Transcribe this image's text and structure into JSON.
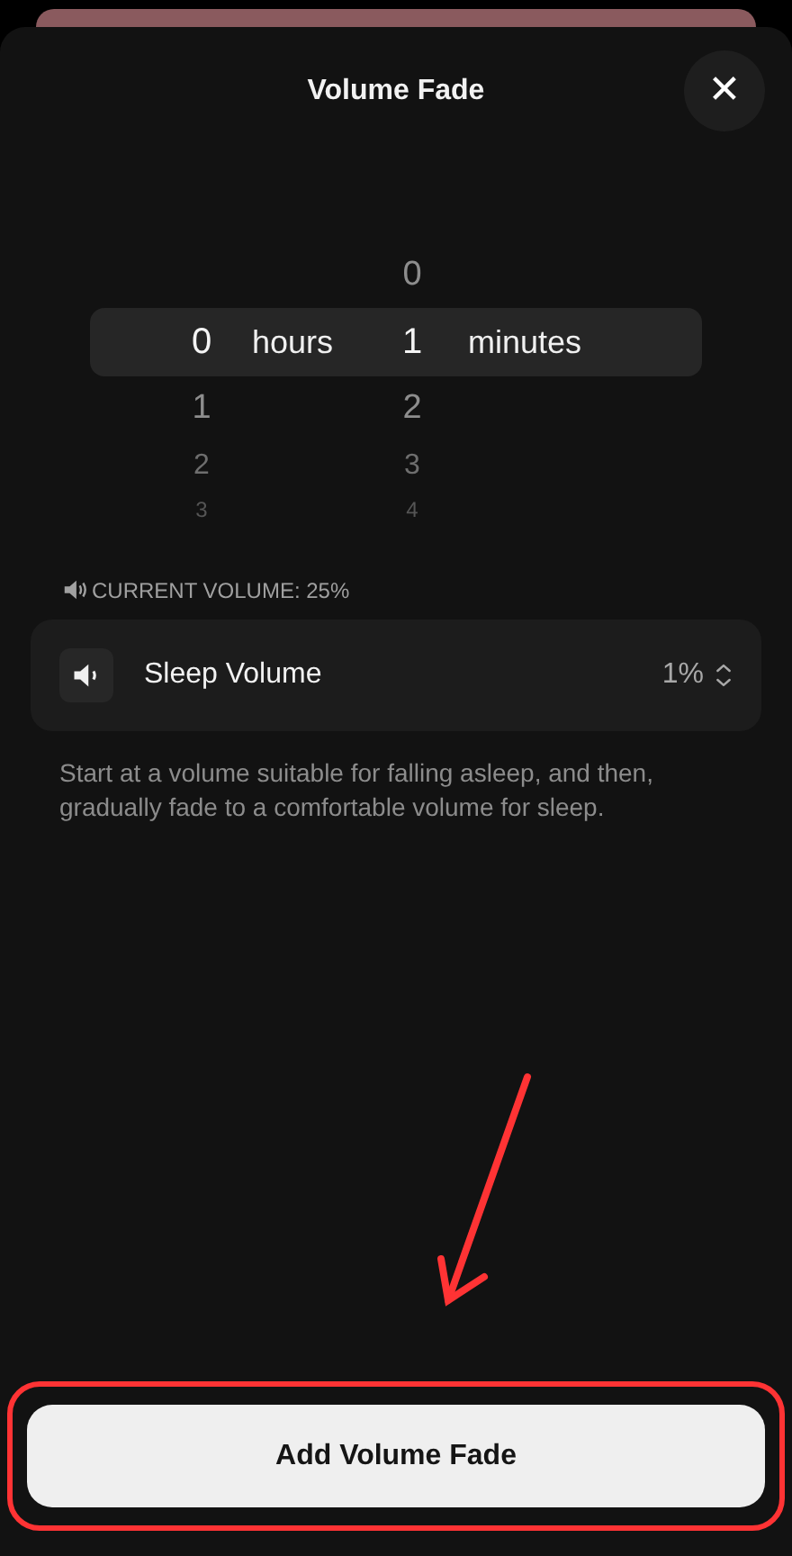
{
  "sheet": {
    "title": "Volume Fade",
    "close_label": "✕"
  },
  "picker": {
    "columns": [
      {
        "unit": "hours",
        "items": [
          {
            "label": "0",
            "selected": true
          },
          {
            "label": "1",
            "selected": false
          },
          {
            "label": "2",
            "selected": false
          },
          {
            "label": "3",
            "selected": false
          }
        ]
      },
      {
        "unit": "minutes",
        "items": [
          {
            "label": "0",
            "selected": false
          },
          {
            "label": "1",
            "selected": true
          },
          {
            "label": "2",
            "selected": false
          },
          {
            "label": "3",
            "selected": false
          },
          {
            "label": "4",
            "selected": false
          }
        ]
      }
    ]
  },
  "current_volume": "CURRENT VOLUME: 25%",
  "sleep_volume": {
    "label": "Sleep Volume",
    "value": "1%"
  },
  "description": "Start at a volume suitable for falling asleep, and then, gradually fade to a comfortable volume for sleep.",
  "primary_button": "Add Volume Fade",
  "annotation_arrow": {
    "color": "#ff3334"
  },
  "annotation_outline": {
    "color": "#ff3334"
  }
}
